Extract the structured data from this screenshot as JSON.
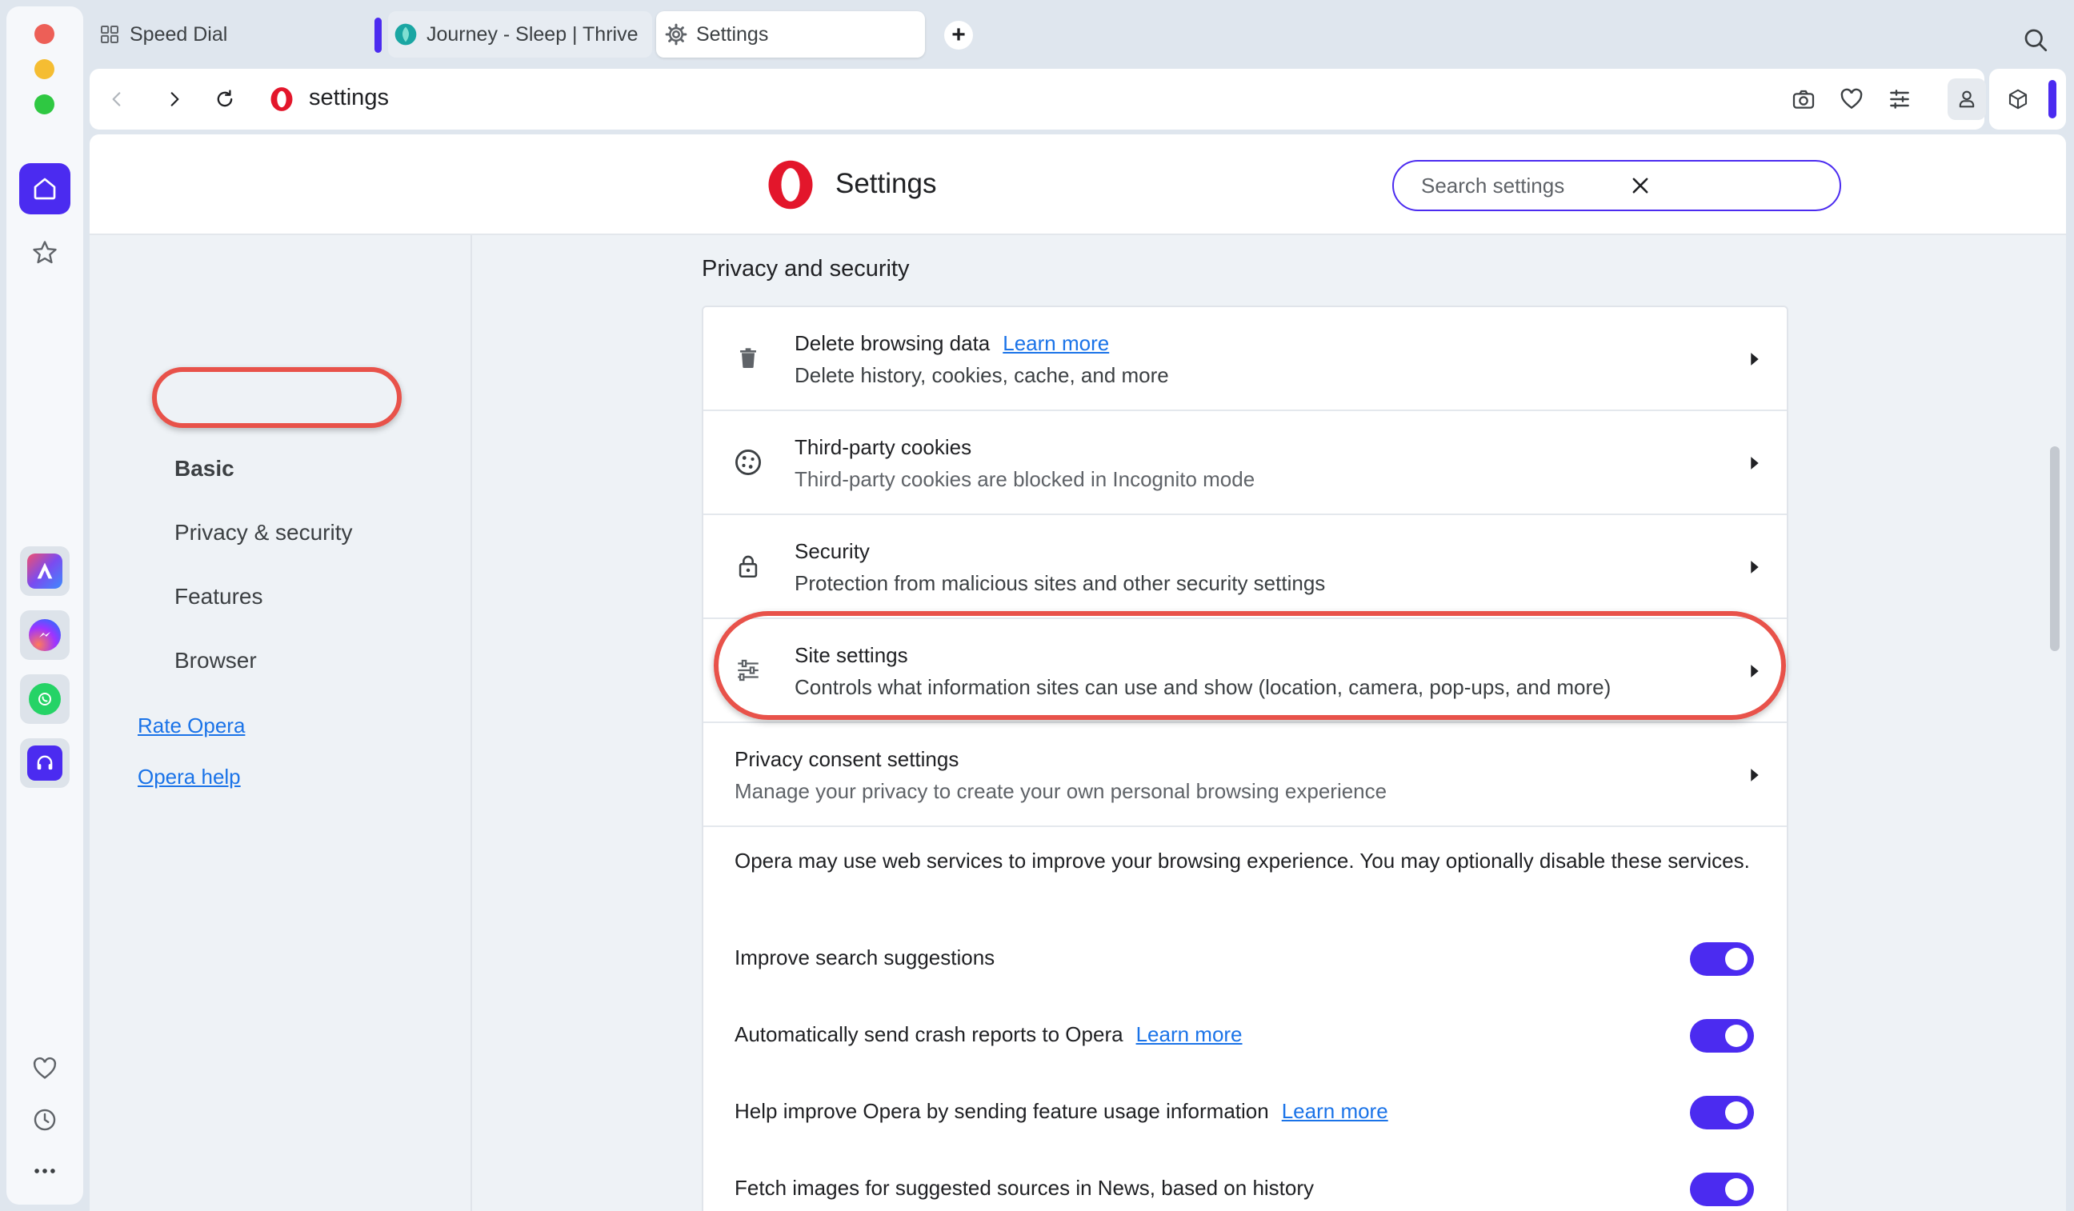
{
  "tabs": [
    {
      "label": "Speed Dial",
      "active": false
    },
    {
      "label": "Journey - Sleep | Thrive",
      "active": false
    },
    {
      "label": "Settings",
      "active": true
    }
  ],
  "address": {
    "url": "settings"
  },
  "header": {
    "title": "Settings",
    "search_placeholder": "Search settings"
  },
  "nav": {
    "items": [
      {
        "label": "Basic"
      },
      {
        "label": "Privacy & security"
      },
      {
        "label": "Features"
      },
      {
        "label": "Browser"
      }
    ],
    "links": [
      {
        "label": "Rate Opera"
      },
      {
        "label": "Opera help"
      }
    ]
  },
  "section": {
    "title": "Privacy and security",
    "rows": [
      {
        "title": "Delete browsing data",
        "link": "Learn more",
        "subtitle": "Delete history, cookies, cache, and more",
        "icon": "trash-icon"
      },
      {
        "title": "Third-party cookies",
        "subtitle": "Third-party cookies are blocked in Incognito mode",
        "icon": "cookie-icon"
      },
      {
        "title": "Security",
        "subtitle": "Protection from malicious sites and other security settings",
        "icon": "lock-icon"
      },
      {
        "title": "Site settings",
        "subtitle": "Controls what information sites can use and show (location, camera, pop-ups, and more)",
        "icon": "sliders-icon"
      },
      {
        "title": "Privacy consent settings",
        "subtitle": "Manage your privacy to create your own personal browsing experience"
      }
    ],
    "info": "Opera may use web services to improve your browsing experience. You may optionally disable these services.",
    "toggles": [
      {
        "label": "Improve search suggestions",
        "on": true
      },
      {
        "label": "Automatically send crash reports to Opera",
        "link": "Learn more",
        "on": true
      },
      {
        "label": "Help improve Opera by sending feature usage information",
        "link": "Learn more",
        "on": true
      },
      {
        "label": "Fetch images for suggested sources in News, based on history",
        "on": true
      }
    ]
  },
  "colors": {
    "accent": "#4b2bf0",
    "annotation": "#e8524a",
    "link": "#1a73e8",
    "opera_red": "#e3162b"
  }
}
